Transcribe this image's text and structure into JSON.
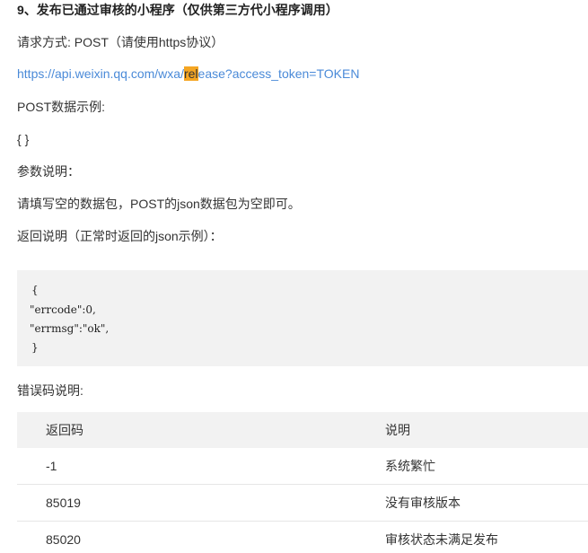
{
  "section": {
    "heading": "9、发布已通过审核的小程序（仅供第三方代小程序调用）",
    "request_method": "请求方式: POST（请使用https协议）",
    "url": {
      "before": "https://api.weixin.qq.com/wxa/",
      "highlight": "rel",
      "after": "ease?access_token=TOKEN"
    },
    "post_example_label": "POST数据示例:",
    "post_example_body": "{ }",
    "params_label": "参数说明：",
    "params_text": "请填写空的数据包，POST的json数据包为空即可。",
    "response_label": "返回说明（正常时返回的json示例）：",
    "code_lines": [
      "{",
      "\"errcode\":0,",
      "\"errmsg\":\"ok\",",
      "}"
    ],
    "error_label": "错误码说明:"
  },
  "error_table": {
    "headers": [
      "返回码",
      "说明"
    ],
    "rows": [
      [
        "-1",
        "系统繁忙"
      ],
      [
        "85019",
        "没有审核版本"
      ],
      [
        "85020",
        "审核状态未满足发布"
      ]
    ]
  },
  "colors": {
    "link": "#4a8ad8",
    "highlight": "#f5a623",
    "code_bg": "#f2f2f2"
  }
}
